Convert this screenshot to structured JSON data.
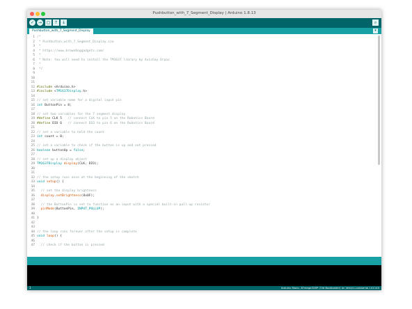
{
  "window": {
    "title": "Pushbutton_with_7_Segment_Display | Arduino 1.8.13"
  },
  "toolbar": {
    "buttons": [
      {
        "name": "verify",
        "icon": "check-icon",
        "glyph": "✓"
      },
      {
        "name": "upload",
        "icon": "arrow-right-icon",
        "glyph": "→"
      },
      {
        "name": "new",
        "icon": "new-file-icon",
        "glyph": "▢"
      },
      {
        "name": "open",
        "icon": "arrow-up-icon",
        "glyph": "↑"
      },
      {
        "name": "save",
        "icon": "arrow-down-icon",
        "glyph": "↓"
      }
    ],
    "serial_monitor_icon": "magnifier-icon",
    "serial_monitor_glyph": "⌕"
  },
  "tabs": {
    "active": "Pushbutton_with_7_Segment_Display",
    "menu_glyph": "▾"
  },
  "editor": {
    "lines": [
      {
        "n": "1",
        "t": "/*"
      },
      {
        "n": "2",
        "t": " * Pushbutton_with_7_Segment_Display.ino"
      },
      {
        "n": "3",
        "t": " *"
      },
      {
        "n": "4",
        "t": " * https://www.brownDoggadgets.com/"
      },
      {
        "n": "5",
        "t": " *"
      },
      {
        "n": "6",
        "t": " * Note: You will need to install the TM1637 library by Avishay Orpaz"
      },
      {
        "n": "7",
        "t": " *"
      },
      {
        "n": "8",
        "t": " */"
      },
      {
        "n": "9",
        "t": ""
      },
      {
        "n": "10",
        "t": ""
      },
      {
        "n": "11",
        "t": ""
      },
      {
        "n": "12",
        "t": "#include <Arduino.h>"
      },
      {
        "n": "13",
        "t": "#include <TM1637Display.h>"
      },
      {
        "n": "14",
        "t": ""
      },
      {
        "n": "15",
        "t": "// set variable name for a digital input pin"
      },
      {
        "n": "16",
        "t": "int ButtonPin = 8;"
      },
      {
        "n": "17",
        "t": ""
      },
      {
        "n": "18",
        "t": "// set two variables for the 7 segment display"
      },
      {
        "n": "19",
        "t": "#define CLK 5   // connect CLK to pin 5 on the Robotics Board"
      },
      {
        "n": "20",
        "t": "#define DIO 6   // connect DIO to pin 6 on the Robotics Board"
      },
      {
        "n": "21",
        "t": ""
      },
      {
        "n": "22",
        "t": "// set a variable to hold the count"
      },
      {
        "n": "23",
        "t": "int count = 0;"
      },
      {
        "n": "24",
        "t": ""
      },
      {
        "n": "25",
        "t": "// set a variable to check if the button is up and not pressed"
      },
      {
        "n": "26",
        "t": "boolean buttonUp = false;"
      },
      {
        "n": "27",
        "t": ""
      },
      {
        "n": "28",
        "t": "// set up a display object"
      },
      {
        "n": "29",
        "t": "TM1637Display display(CLK, DIO);"
      },
      {
        "n": "30",
        "t": ""
      },
      {
        "n": "31",
        "t": ""
      },
      {
        "n": "32",
        "t": "// the setup runs once at the beginning of the sketch"
      },
      {
        "n": "33",
        "t": "void setup() {"
      },
      {
        "n": "34",
        "t": ""
      },
      {
        "n": "35",
        "t": "  // set the display brightness"
      },
      {
        "n": "36",
        "t": "  display.setBrightness(0x0F);"
      },
      {
        "n": "37",
        "t": ""
      },
      {
        "n": "38",
        "t": "  // the ButtonPin is set to function as an input with a special built-in pull-up resistor"
      },
      {
        "n": "39",
        "t": "  pinMode(ButtonPin, INPUT_PULLUP);"
      },
      {
        "n": "40",
        "t": ""
      },
      {
        "n": "41",
        "t": "}"
      },
      {
        "n": "42",
        "t": ""
      },
      {
        "n": "43",
        "t": ""
      },
      {
        "n": "44",
        "t": "// the loop runs forever after the setup is complete"
      },
      {
        "n": "45",
        "t": "void loop() {"
      },
      {
        "n": "46",
        "t": ""
      },
      {
        "n": "47",
        "t": "  // check if the button is pressed"
      }
    ]
  },
  "status": {
    "line": "1",
    "board": "Arduino Nano, ATmega328P (Old Bootloader) on /dev/cu.usbserial-141140"
  },
  "colors": {
    "toolbar": "#006468",
    "tabbar": "#17a1a5",
    "console": "#000000",
    "comment": "#95a5a6",
    "keyword": "#00979c",
    "function": "#d35400"
  }
}
